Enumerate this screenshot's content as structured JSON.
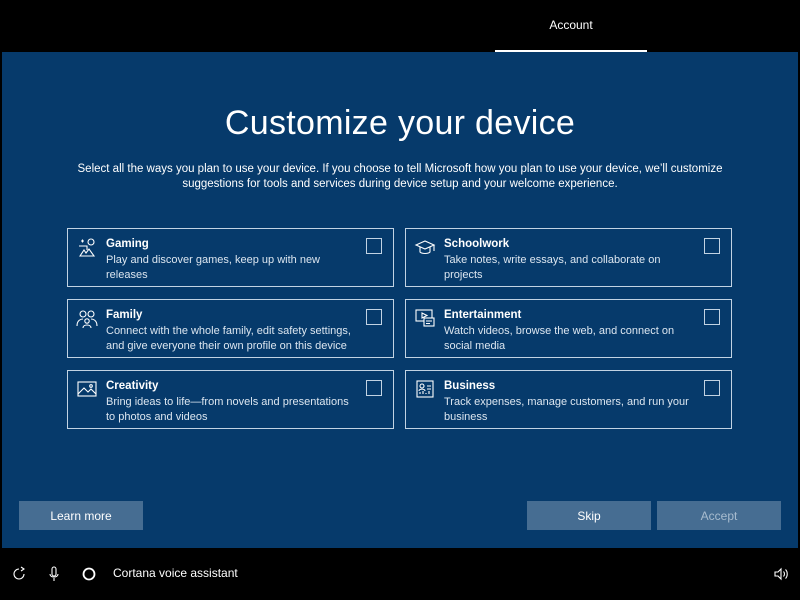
{
  "header": {
    "tab_label": "Account"
  },
  "page": {
    "title": "Customize your device",
    "description": "Select all the ways you plan to use your device. If you choose to tell Microsoft how you plan to use your device, we’ll customize suggestions for tools and services during device setup and your welcome experience."
  },
  "cards": [
    {
      "icon": "gaming-icon",
      "title": "Gaming",
      "description": "Play and discover games, keep up with new releases",
      "checked": false
    },
    {
      "icon": "schoolwork-icon",
      "title": "Schoolwork",
      "description": "Take notes, write essays, and collaborate on projects",
      "checked": false
    },
    {
      "icon": "family-icon",
      "title": "Family",
      "description": "Connect with the whole family, edit safety settings, and give everyone their own profile on this device",
      "checked": false
    },
    {
      "icon": "entertainment-icon",
      "title": "Entertainment",
      "description": "Watch videos, browse the web, and connect on social media",
      "checked": false
    },
    {
      "icon": "creativity-icon",
      "title": "Creativity",
      "description": "Bring ideas to life—from novels and presentations to photos and videos",
      "checked": false
    },
    {
      "icon": "business-icon",
      "title": "Business",
      "description": "Track expenses, manage customers, and run your business",
      "checked": false
    }
  ],
  "buttons": {
    "learn_more": "Learn more",
    "skip": "Skip",
    "accept": "Accept",
    "accept_enabled": false
  },
  "bottom_bar": {
    "cortana_label": "Cortana voice assistant",
    "icons": [
      "ease-of-access-icon",
      "microphone-icon",
      "cortana-icon",
      "volume-icon"
    ]
  },
  "colors": {
    "background": "#063a6b",
    "button": "#466d92",
    "border": "#c2d3e3"
  }
}
